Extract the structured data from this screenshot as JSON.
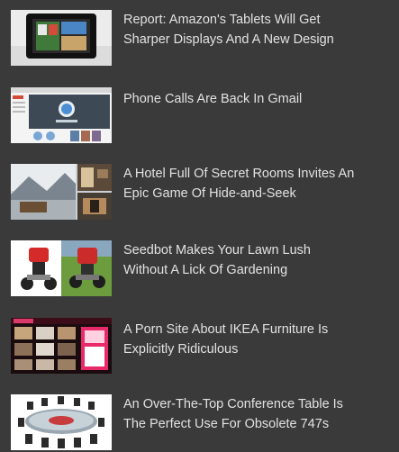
{
  "stories": [
    {
      "thumbnail": "amazon-tablet-image",
      "headline_lines": [
        "Report: Amazon's Tablets Will Get",
        "Sharper Displays And A New Design"
      ]
    },
    {
      "thumbnail": "gmail-phone-call-image",
      "headline_lines": [
        "Phone Calls Are Back In Gmail"
      ]
    },
    {
      "thumbnail": "hotel-hidden-rooms-image",
      "headline_lines": [
        "A Hotel Full Of Secret Rooms Invites An",
        "Epic Game Of Hide-and-Seek"
      ]
    },
    {
      "thumbnail": "seedbot-robot-image",
      "headline_lines": [
        "Seedbot Makes Your Lawn Lush",
        "Without A Lick Of Gardening"
      ]
    },
    {
      "thumbnail": "ikea-site-screenshot-image",
      "headline_lines": [
        "A Porn Site About IKEA Furniture Is",
        "Explicitly Ridiculous"
      ]
    },
    {
      "thumbnail": "conference-table-image",
      "headline_lines": [
        "An Over-The-Top Conference Table Is",
        "The Perfect Use For Obsolete 747s"
      ]
    }
  ]
}
